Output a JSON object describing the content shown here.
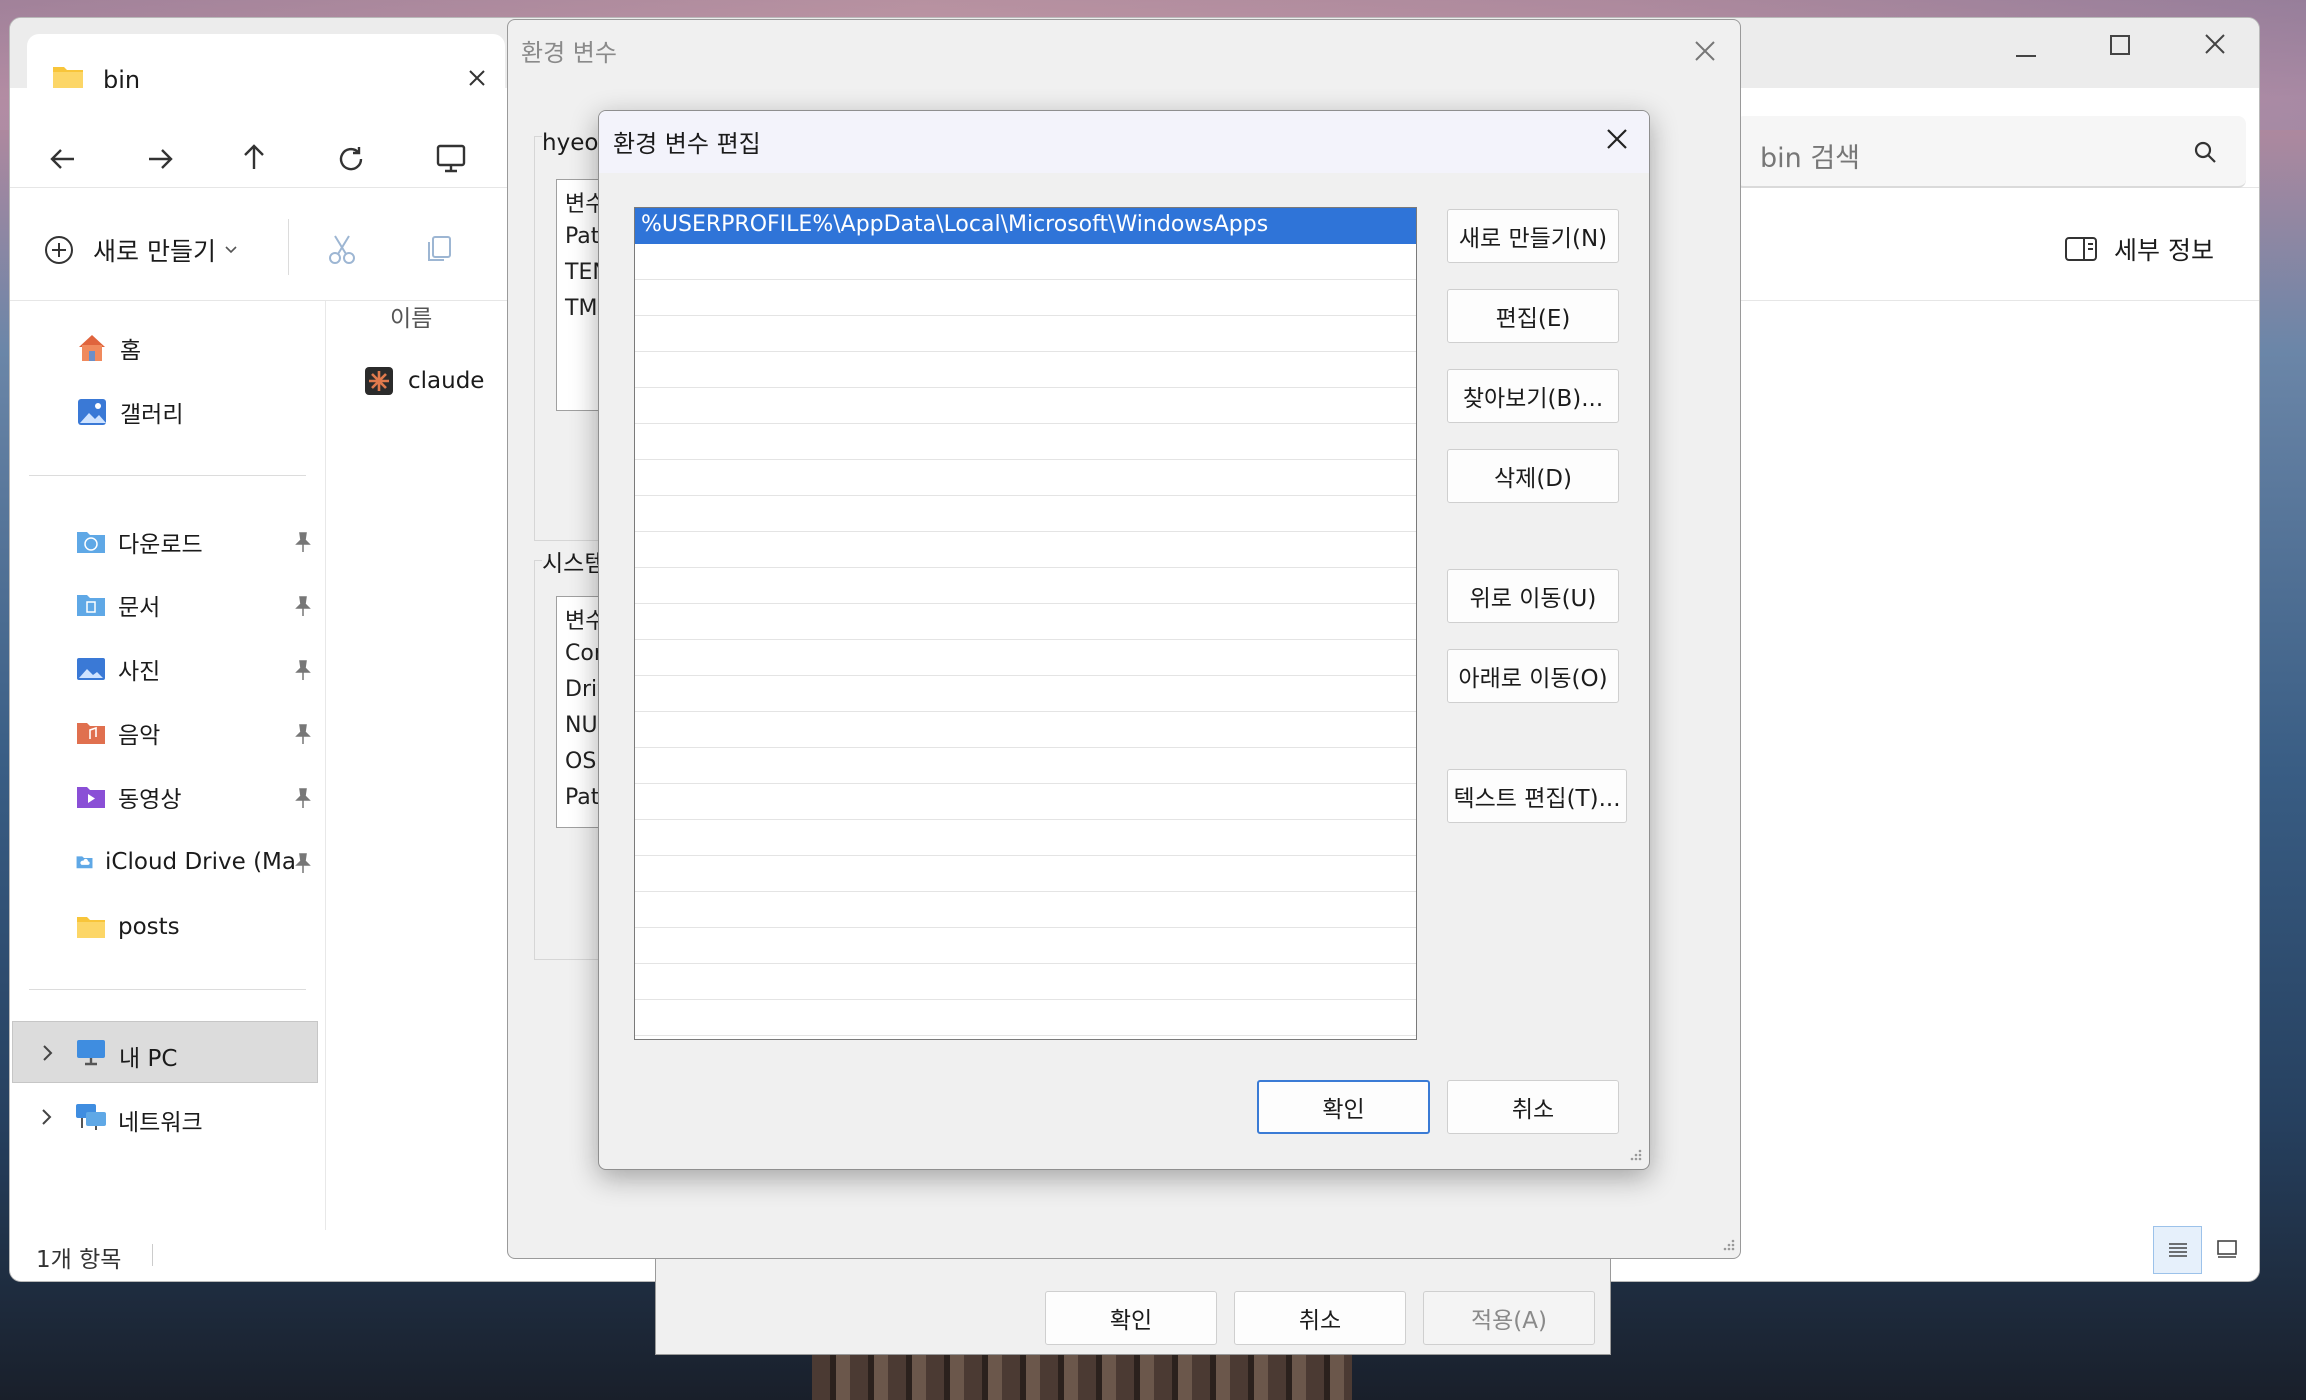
{
  "explorer": {
    "tab_title": "bin",
    "search_placeholder": "bin 검색",
    "new_label": "새로 만들기",
    "details_label": "세부 정보",
    "column_name": "이름",
    "file_name": "claude",
    "status_text": "1개 항목",
    "sidebar": {
      "home": "홈",
      "gallery": "갤러리",
      "downloads": "다운로드",
      "documents": "문서",
      "pictures": "사진",
      "music": "음악",
      "videos": "동영상",
      "icloud": "iCloud Drive (Ma",
      "posts": "posts",
      "this_pc": "내 PC",
      "network": "네트워크"
    }
  },
  "env_dialog": {
    "title": "환경 변수",
    "user_group_label": "hyeon",
    "user_col_header": "변수",
    "user_rows": [
      "Pat",
      "TEN",
      "TMI"
    ],
    "system_group_label": "시스템",
    "system_col_header": "변수",
    "system_rows": [
      "Cor",
      "Driv",
      "NU",
      "OS",
      "Pat"
    ]
  },
  "back_dialog": {
    "ok": "확인",
    "cancel": "취소",
    "apply": "적용(A)"
  },
  "edit_dialog": {
    "title": "환경 변수 편집",
    "paths": [
      "%USERPROFILE%\\AppData\\Local\\Microsoft\\WindowsApps"
    ],
    "buttons": {
      "new": "새로 만들기(N)",
      "edit": "편집(E)",
      "browse": "찾아보기(B)...",
      "delete": "삭제(D)",
      "move_up": "위로 이동(U)",
      "move_down": "아래로 이동(O)",
      "edit_text": "텍스트 편집(T)...",
      "ok": "확인",
      "cancel": "취소"
    }
  },
  "colors": {
    "selection": "#2f74d8",
    "accent": "#0067c0"
  }
}
